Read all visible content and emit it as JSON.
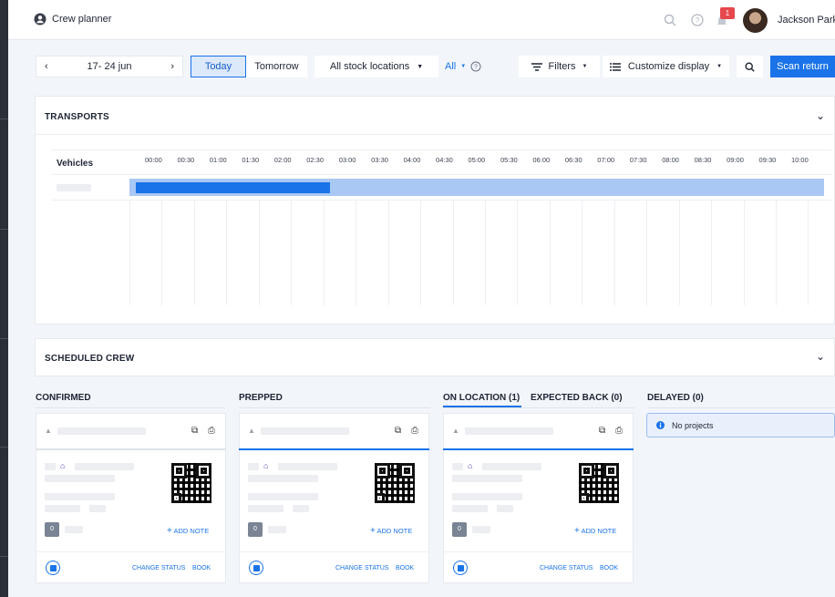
{
  "header": {
    "title": "Crew planner",
    "user_name": "Jackson Parke",
    "notifications": "1"
  },
  "toolbar": {
    "date_range": "17- 24 jun",
    "today": "Today",
    "tomorrow": "Tomorrow",
    "stock": "All stock locations",
    "all": "All",
    "filters": "Filters",
    "customize": "Customize display",
    "scan": "Scan return"
  },
  "transports": {
    "title": "TRANSPORTS",
    "vehicles_label": "Vehicles",
    "times": [
      "00:00",
      "00:30",
      "01:00",
      "01:30",
      "02:00",
      "02:30",
      "03:00",
      "03:30",
      "04:00",
      "04:30",
      "05:00",
      "05:30",
      "06:00",
      "06:30",
      "07:00",
      "07:30",
      "08:00",
      "08:30",
      "09:00",
      "09:30",
      "10:00"
    ]
  },
  "crew": {
    "title": "SCHEDULED CREW"
  },
  "columns": {
    "confirmed": "CONFIRMED",
    "prepped": "PREPPED",
    "on_location": "ON LOCATION (1)",
    "expected_back": "EXPECTED BACK (0)",
    "delayed": "DELAYED (0)",
    "no_projects": "No projects"
  },
  "card": {
    "count": "0",
    "add_note": "ADD NOTE",
    "change_status": "CHANGE STATUS",
    "book": "BOOK"
  },
  "icons": [
    "user-circle-icon",
    "search-icon",
    "help-icon",
    "bell-icon",
    "chevron-left-icon",
    "chevron-right-icon",
    "caret-down-icon",
    "filter-icon",
    "list-icon",
    "chevron-down-icon",
    "warehouse-icon",
    "external-link-icon",
    "print-icon",
    "info-icon",
    "plus-icon"
  ]
}
